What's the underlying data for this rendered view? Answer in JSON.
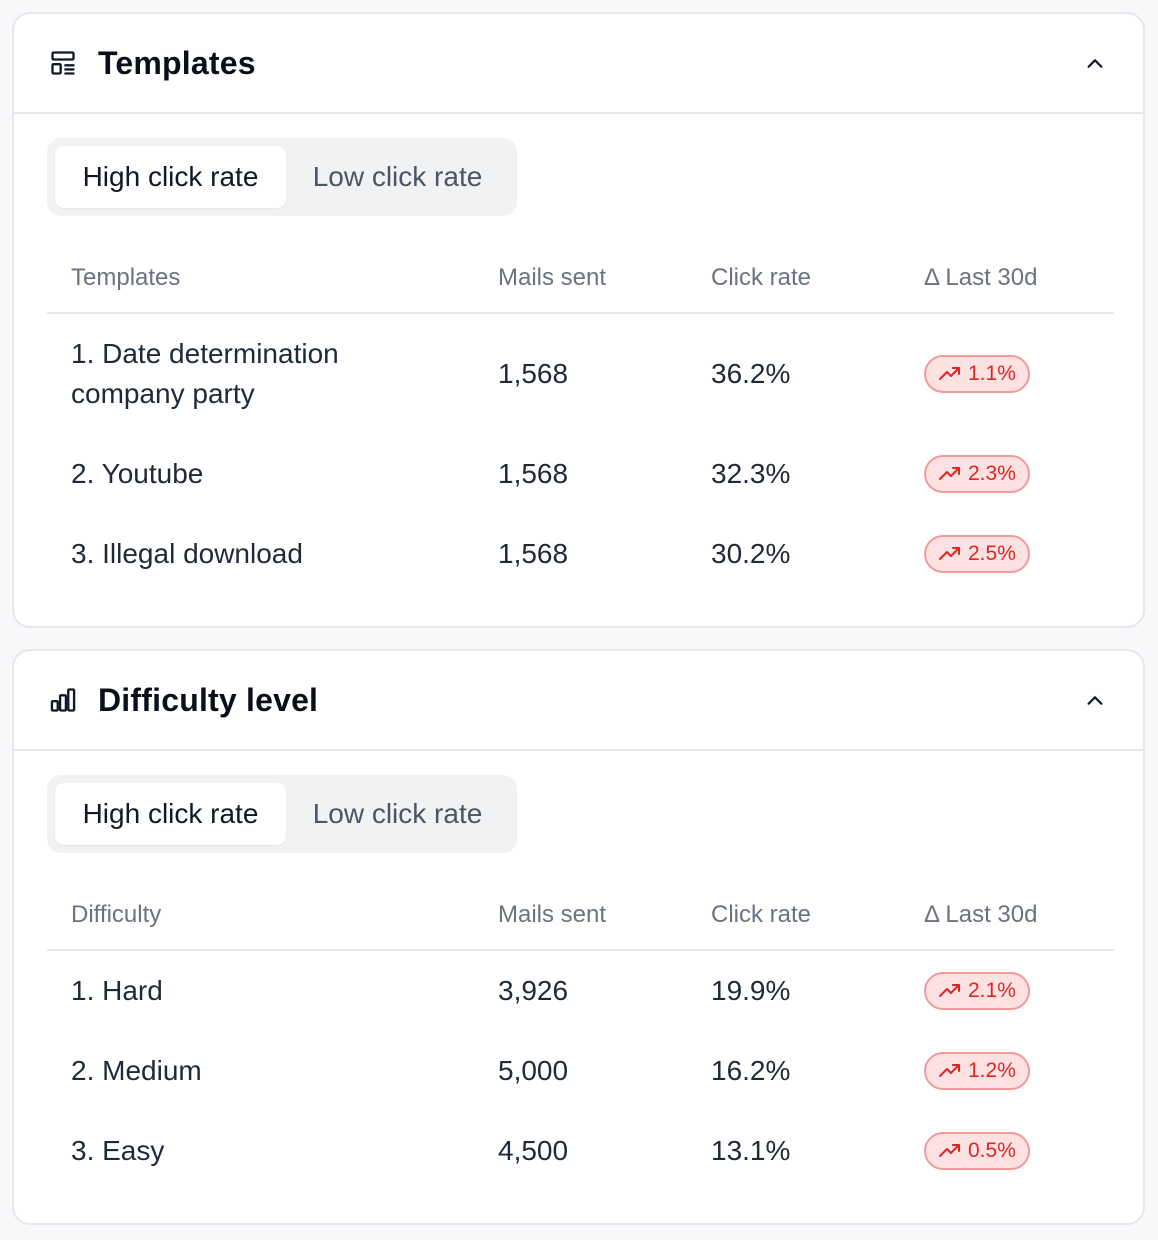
{
  "colors": {
    "badge_bg": "#fee2e2",
    "badge_border": "#f19a9a",
    "badge_text": "#dc2626",
    "border": "#e5e7eb",
    "muted_text": "#6b7280"
  },
  "templates": {
    "icon": "template-layout-icon",
    "title": "Templates",
    "tabs": {
      "active": "High click rate",
      "inactive": "Low click rate"
    },
    "headers": {
      "name": "Templates",
      "sent": "Mails sent",
      "rate": "Click rate",
      "delta": "Δ Last 30d"
    },
    "rows": [
      {
        "name": "1. Date determination company party",
        "sent": "1,568",
        "rate": "36.2%",
        "delta": "1.1%"
      },
      {
        "name": "2. Youtube",
        "sent": "1,568",
        "rate": "32.3%",
        "delta": "2.3%"
      },
      {
        "name": "3. Illegal download",
        "sent": "1,568",
        "rate": "30.2%",
        "delta": "2.5%"
      }
    ]
  },
  "difficulty": {
    "icon": "bar-chart-icon",
    "title": "Difficulty level",
    "tabs": {
      "active": "High click rate",
      "inactive": "Low click rate"
    },
    "headers": {
      "name": "Difficulty",
      "sent": "Mails sent",
      "rate": "Click rate",
      "delta": "Δ Last 30d"
    },
    "rows": [
      {
        "name": "1. Hard",
        "sent": "3,926",
        "rate": "19.9%",
        "delta": "2.1%"
      },
      {
        "name": "2. Medium",
        "sent": "5,000",
        "rate": "16.2%",
        "delta": "1.2%"
      },
      {
        "name": "3. Easy",
        "sent": "4,500",
        "rate": "13.1%",
        "delta": "0.5%"
      }
    ]
  }
}
